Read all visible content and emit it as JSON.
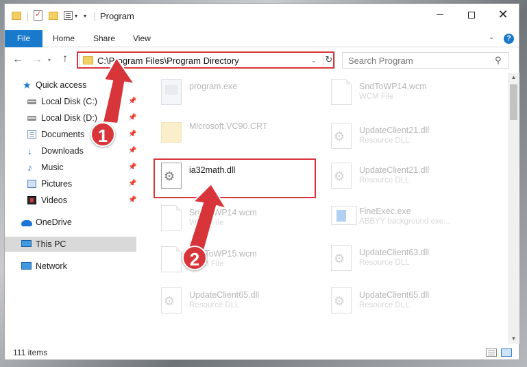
{
  "window": {
    "title": "Program"
  },
  "window_controls": {
    "minimize": "",
    "maximize": "",
    "close": "✕"
  },
  "ribbon": {
    "file": "File",
    "tabs": [
      "Home",
      "Share",
      "View"
    ],
    "help": "?"
  },
  "nav": {
    "back": "←",
    "forward": "→",
    "up": "↑",
    "address": "C:\\Program Files\\Program Directory",
    "refresh": "↻",
    "search_placeholder": "Search Program"
  },
  "sidebar": {
    "items": [
      {
        "label": "Quick access",
        "icon": "star-icon"
      },
      {
        "label": "Local Disk (C:)",
        "icon": "drive-icon",
        "pinned": true
      },
      {
        "label": "Local Disk (D:)",
        "icon": "drive-icon",
        "pinned": true
      },
      {
        "label": "Documents",
        "icon": "documents-icon",
        "pinned": true
      },
      {
        "label": "Downloads",
        "icon": "download-icon",
        "pinned": true
      },
      {
        "label": "Music",
        "icon": "music-icon",
        "pinned": true
      },
      {
        "label": "Pictures",
        "icon": "pictures-icon",
        "pinned": true
      },
      {
        "label": "Videos",
        "icon": "videos-icon",
        "pinned": true
      },
      {
        "label": "OneDrive",
        "icon": "onedrive-icon"
      },
      {
        "label": "This PC",
        "icon": "computer-icon",
        "selected": true
      },
      {
        "label": "Network",
        "icon": "network-icon"
      }
    ]
  },
  "files": {
    "left": [
      {
        "name": "program.exe",
        "type": "",
        "icon": "exe-icon"
      },
      {
        "name": "Microsoft.VC90.CRT",
        "type": "",
        "icon": "folder-icon"
      },
      {
        "name": "ia32math.dll",
        "type": "",
        "icon": "dll-icon",
        "highlighted": true
      },
      {
        "name": "SndToWP14.wcm",
        "type": "WCM File",
        "icon": "file-icon"
      },
      {
        "name": "SndToWP15.wcm",
        "type": "WCM File",
        "icon": "file-icon"
      },
      {
        "name": "UpdateClient65.dll",
        "type": "Resource DLL",
        "icon": "dll-icon"
      }
    ],
    "right": [
      {
        "name": "SndToWP14.wcm",
        "type": "WCM File",
        "icon": "file-icon"
      },
      {
        "name": "UpdateClient21.dll",
        "type": "Resource DLL",
        "icon": "dll-icon"
      },
      {
        "name": "UpdateClient21.dll",
        "type": "Resource DLL",
        "icon": "dll-icon"
      },
      {
        "name": "FineExec.exe",
        "type": "ABBYY background exe...",
        "icon": "fineexec-icon"
      },
      {
        "name": "UpdateClient63.dll",
        "type": "Resource DLL",
        "icon": "dll-icon"
      },
      {
        "name": "UpdateClient65.dll",
        "type": "Resource DLL",
        "icon": "dll-icon"
      }
    ]
  },
  "status": {
    "count": "111 items"
  },
  "annotations": {
    "step1": "1",
    "step2": "2"
  },
  "colors": {
    "accent": "#1979ca",
    "highlight": "#d8353b",
    "selection": "#d9d9d9"
  }
}
